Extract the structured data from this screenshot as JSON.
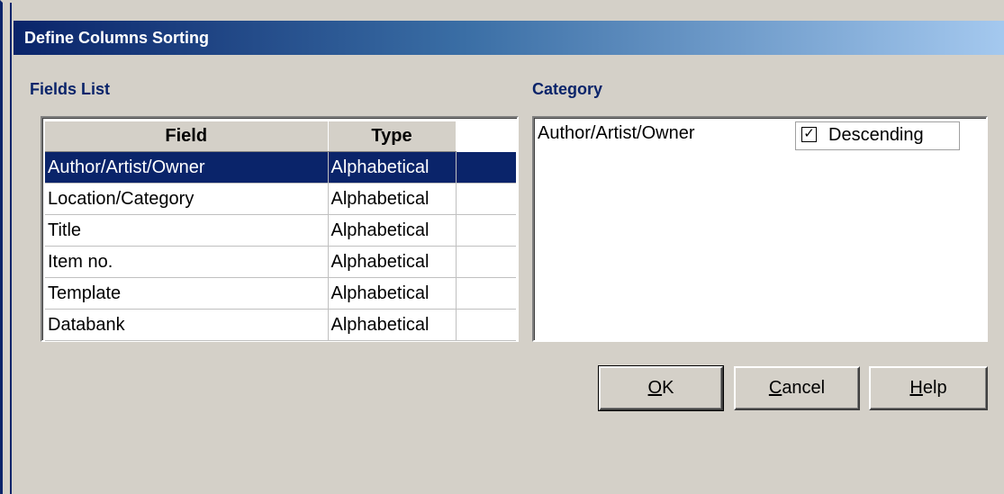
{
  "window": {
    "title": "Define Columns Sorting"
  },
  "fields_list": {
    "heading": "Fields List",
    "columns": [
      "Field",
      "Type"
    ],
    "rows": [
      {
        "field": "Author/Artist/Owner",
        "type": "Alphabetical",
        "selected": true
      },
      {
        "field": "Location/Category",
        "type": "Alphabetical",
        "selected": false
      },
      {
        "field": "Title",
        "type": "Alphabetical",
        "selected": false
      },
      {
        "field": "Item no.",
        "type": "Alphabetical",
        "selected": false
      },
      {
        "field": "Template",
        "type": "Alphabetical",
        "selected": false
      },
      {
        "field": "Databank",
        "type": "Alphabetical",
        "selected": false
      }
    ]
  },
  "category": {
    "heading": "Category",
    "items": [
      {
        "name": "Author/Artist/Owner",
        "descending_label": "Descending",
        "descending_checked": true
      }
    ]
  },
  "buttons": {
    "ok": {
      "mnemonic": "O",
      "rest": "K"
    },
    "cancel": {
      "mnemonic": "C",
      "rest": "ancel"
    },
    "help": {
      "mnemonic": "H",
      "rest": "elp"
    }
  },
  "colors": {
    "title_bar": "#0a246a",
    "selection": "#0a246a",
    "dialog_bg": "#d4d0c8"
  }
}
